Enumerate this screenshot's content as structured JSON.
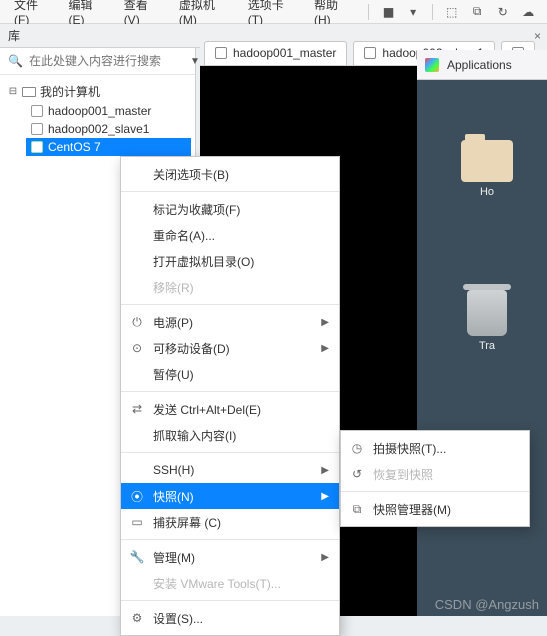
{
  "menubar": {
    "items": [
      "文件(F)",
      "编辑(E)",
      "查看(V)",
      "虚拟机(M)",
      "选项卡(T)",
      "帮助(H)"
    ]
  },
  "toolbar_icons": [
    "pause",
    "power",
    "box1",
    "box2",
    "clock",
    "snapshot"
  ],
  "library": {
    "title": "库",
    "pin": "📌"
  },
  "search": {
    "placeholder": "在此处键入内容进行搜索"
  },
  "tree": {
    "root": "我的计算机",
    "children": [
      {
        "label": "hadoop001_master",
        "on": false
      },
      {
        "label": "hadoop002_slave1",
        "on": false
      },
      {
        "label": "CentOS 7",
        "on": true,
        "selected": true
      }
    ]
  },
  "tabs": [
    {
      "label": "hadoop001_master"
    },
    {
      "label": "hadoop002_slave1"
    }
  ],
  "desktop": {
    "app_label": "Applications",
    "icons": [
      {
        "kind": "folder",
        "label": "Ho"
      },
      {
        "kind": "trash",
        "label": "Tra"
      }
    ]
  },
  "context_menu": [
    {
      "label": "关闭选项卡(B)"
    },
    {
      "divider": true
    },
    {
      "label": "标记为收藏项(F)"
    },
    {
      "label": "重命名(A)..."
    },
    {
      "label": "打开虚拟机目录(O)"
    },
    {
      "label": "移除(R)",
      "disabled": true
    },
    {
      "divider": true
    },
    {
      "icon": "⏻",
      "label": "电源(P)",
      "submenu": true
    },
    {
      "icon": "⊙",
      "label": "可移动设备(D)",
      "submenu": true
    },
    {
      "label": "暂停(U)"
    },
    {
      "divider": true
    },
    {
      "icon": "⇄",
      "label": "发送 Ctrl+Alt+Del(E)"
    },
    {
      "label": "抓取输入内容(I)"
    },
    {
      "divider": true
    },
    {
      "label": "SSH(H)",
      "submenu": true
    },
    {
      "icon": "⦿",
      "label": "快照(N)",
      "submenu": true,
      "selected": true
    },
    {
      "icon": "▭",
      "label": "捕获屏幕 (C)"
    },
    {
      "divider": true
    },
    {
      "icon": "🔧",
      "label": "管理(M)",
      "submenu": true
    },
    {
      "label": "安装 VMware Tools(T)...",
      "disabled": true
    },
    {
      "divider": true
    },
    {
      "icon": "⚙",
      "label": "设置(S)..."
    }
  ],
  "snapshot_submenu": [
    {
      "icon": "◷",
      "label": "拍摄快照(T)..."
    },
    {
      "icon": "↺",
      "label": "恢复到快照",
      "disabled": true
    },
    {
      "divider": true
    },
    {
      "icon": "⧉",
      "label": "快照管理器(M)"
    }
  ],
  "watermark": "CSDN @Angzush"
}
